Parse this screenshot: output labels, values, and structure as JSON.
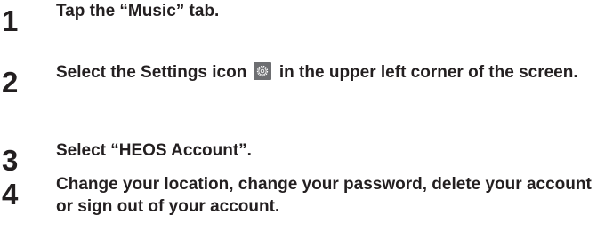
{
  "steps": [
    {
      "number": "1",
      "text": "Tap the “Music” tab."
    },
    {
      "number": "2",
      "text_before_icon": "Select the Settings icon",
      "icon": "settings-gear-icon",
      "text_after_icon": "in the upper left corner of the screen."
    },
    {
      "number": "3",
      "text": "Select “HEOS Account”."
    },
    {
      "number": "4",
      "text": "Change your location, change your password, delete your account or sign out of your account."
    }
  ],
  "colors": {
    "text": "#231f20",
    "icon_background": "#6d6e71",
    "icon_foreground": "#ffffff"
  }
}
